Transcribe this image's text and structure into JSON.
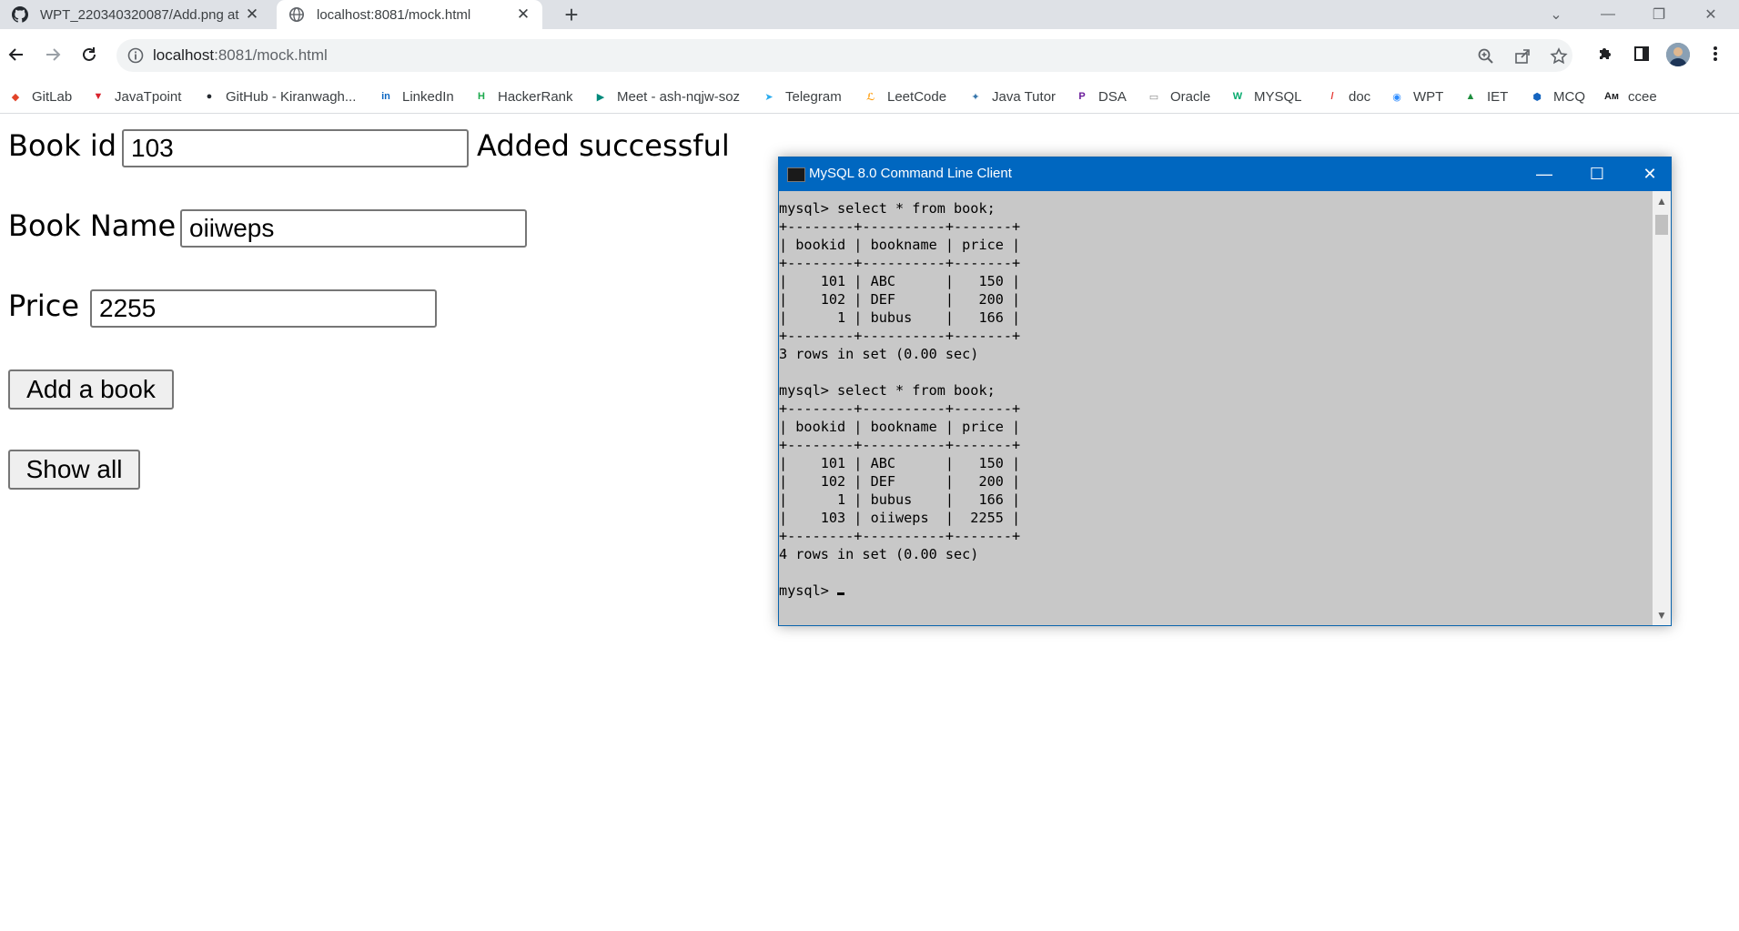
{
  "browser": {
    "tabs": [
      {
        "title": "WPT_220340320087/Add.png at",
        "active": false,
        "icon": "github-icon"
      },
      {
        "title": "localhost:8081/mock.html",
        "active": true,
        "icon": "globe-icon"
      }
    ],
    "url_host": "localhost",
    "url_rest": ":8081/mock.html",
    "bookmarks": [
      {
        "label": "GitLab",
        "icon": "gitlab-icon",
        "color": "#e24329"
      },
      {
        "label": "JavaTpoint",
        "icon": "javatpoint-icon",
        "color": "#d9232d"
      },
      {
        "label": "GitHub - Kiranwagh...",
        "icon": "github-icon",
        "color": "#24292f"
      },
      {
        "label": "LinkedIn",
        "icon": "linkedin-icon",
        "color": "#0a66c2"
      },
      {
        "label": "HackerRank",
        "icon": "hackerrank-icon",
        "color": "#1ba94c"
      },
      {
        "label": "Meet - ash-nqjw-soz",
        "icon": "meet-icon",
        "color": "#00897b"
      },
      {
        "label": "Telegram",
        "icon": "telegram-icon",
        "color": "#2aabee"
      },
      {
        "label": "LeetCode",
        "icon": "leetcode-icon",
        "color": "#ffa116"
      },
      {
        "label": "Java Tutor",
        "icon": "python-icon",
        "color": "#3776ab"
      },
      {
        "label": "DSA",
        "icon": "dsa-icon",
        "color": "#6a1b9a"
      },
      {
        "label": "Oracle",
        "icon": "oracle-icon",
        "color": "#8a8a8a"
      },
      {
        "label": "MYSQL",
        "icon": "w3schools-icon",
        "color": "#04aa6d"
      },
      {
        "label": "doc",
        "icon": "doc-icon",
        "color": "#e53935"
      },
      {
        "label": "WPT",
        "icon": "zoom-icon",
        "color": "#2d8cff"
      },
      {
        "label": "IET",
        "icon": "drive-icon",
        "color": "#1e8e3e"
      },
      {
        "label": "MCQ",
        "icon": "mcq-icon",
        "color": "#1565c0"
      },
      {
        "label": "ccee",
        "icon": "ccee-icon",
        "color": "#202124"
      }
    ]
  },
  "form": {
    "book_id_label": "Book id",
    "book_id_value": "103",
    "status_message": "Added successful",
    "book_name_label": "Book Name",
    "book_name_value": "oiiweps",
    "price_label": "Price",
    "price_value": "2255",
    "add_button": "Add a book",
    "show_all_button": "Show all"
  },
  "console": {
    "title": "MySQL 8.0 Command Line Client",
    "output": "mysql> select * from book;\n+--------+----------+-------+\n| bookid | bookname | price |\n+--------+----------+-------+\n|    101 | ABC      |   150 |\n|    102 | DEF      |   200 |\n|      1 | bubus    |   166 |\n+--------+----------+-------+\n3 rows in set (0.00 sec)\n\nmysql> select * from book;\n+--------+----------+-------+\n| bookid | bookname | price |\n+--------+----------+-------+\n|    101 | ABC      |   150 |\n|    102 | DEF      |   200 |\n|      1 | bubus    |   166 |\n|    103 | oiiweps  |  2255 |\n+--------+----------+-------+\n4 rows in set (0.00 sec)\n\n",
    "prompt": "mysql> "
  }
}
